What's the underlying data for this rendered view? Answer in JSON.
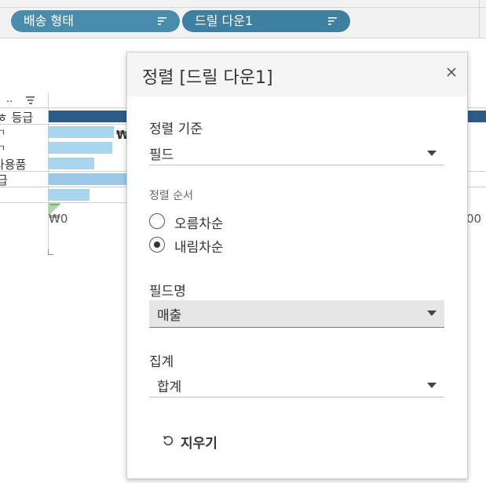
{
  "shelf": {
    "pills": [
      {
        "label": "배송 형태"
      },
      {
        "label": "드릴 다운1"
      }
    ]
  },
  "worksheet": {
    "header_text": "..",
    "row_labels": [
      "ㅎ 등급",
      "ㄱ",
      "ㄱ",
      "사용품",
      "급"
    ],
    "currency_label": "₩",
    "axis_ticks": [
      "₩0",
      "00"
    ]
  },
  "dialog": {
    "title": "정렬 [드릴 다운1]",
    "sort_by": {
      "label": "정렬 기준",
      "value": "필드"
    },
    "sort_order": {
      "label": "정렬 순서",
      "options": [
        {
          "label": "오름차순",
          "selected": false
        },
        {
          "label": "내림차순",
          "selected": true
        }
      ]
    },
    "field_name": {
      "label": "필드명",
      "value": "매출"
    },
    "aggregation": {
      "label": "집계",
      "value": "합계"
    },
    "clear_label": "지우기"
  },
  "colors": {
    "pill": "#4a8aa8",
    "dark_bar": "#2c5b8a",
    "light_bar": "#a9d6ee",
    "mid_bar": "#9cc9e8"
  }
}
